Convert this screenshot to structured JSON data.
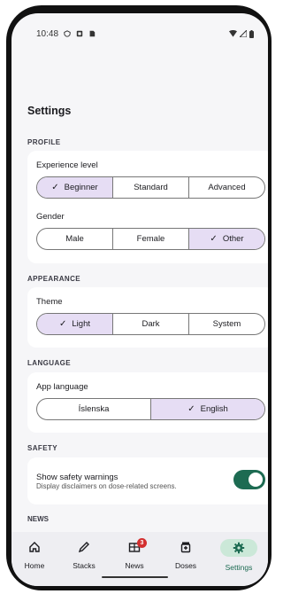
{
  "status_bar": {
    "time": "10:48"
  },
  "page_title": "Settings",
  "profile": {
    "section_label": "PROFILE",
    "experience": {
      "label": "Experience level",
      "options": [
        "Beginner",
        "Standard",
        "Advanced"
      ],
      "selected": "Beginner"
    },
    "gender": {
      "label": "Gender",
      "options": [
        "Male",
        "Female",
        "Other"
      ],
      "selected": "Other"
    }
  },
  "appearance": {
    "section_label": "APPEARANCE",
    "theme": {
      "label": "Theme",
      "options": [
        "Light",
        "Dark",
        "System"
      ],
      "selected": "Light"
    }
  },
  "language": {
    "section_label": "LANGUAGE",
    "app_language": {
      "label": "App language",
      "options": [
        "Íslenska",
        "English"
      ],
      "selected": "English"
    }
  },
  "safety": {
    "section_label": "SAFETY",
    "warnings_title": "Show safety warnings",
    "warnings_desc": "Display disclaimers on dose-related screens.",
    "enabled": true
  },
  "next_section_label": "NEWS",
  "bottom_nav": {
    "items": [
      {
        "label": "Home",
        "icon": "home-icon"
      },
      {
        "label": "Stacks",
        "icon": "pencil-icon"
      },
      {
        "label": "News",
        "icon": "news-icon",
        "badge": "3"
      },
      {
        "label": "Doses",
        "icon": "doses-icon"
      },
      {
        "label": "Settings",
        "icon": "gear-icon"
      }
    ],
    "active": "Settings"
  },
  "colors": {
    "selected_segment": "#e6ddf4",
    "toggle_on": "#1d6b52",
    "active_nav_pill": "#cbe8d8",
    "badge": "#d32f2f"
  }
}
